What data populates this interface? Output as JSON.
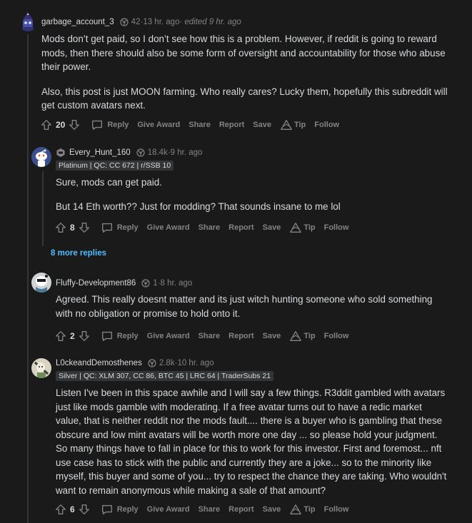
{
  "comments": [
    {
      "username": "garbage_account_3",
      "karma": "42",
      "time": "13 hr. ago",
      "edited": "edited 9 hr. ago",
      "paragraphs": [
        "Mods don’t get paid, so I don’t see how this is a problem. However, if reddit is going to reward mods, then there should also be some form of oversight and accountability for those who abuse their power.",
        "Also, this post is just MOON farming. Who really cares? Lucky them, hopefully this subreddit will get custom avatars next."
      ],
      "score": "20"
    },
    {
      "username": "Every_Hunt_160",
      "karma": "18.4k",
      "time": "9 hr. ago",
      "flair": "Platinum | QC: CC 672 | r/SSB 10",
      "paragraphs": [
        "Sure, mods can get paid.",
        "But 14 Eth worth?? Just for modding? That sounds insane to me lol"
      ],
      "score": "8"
    },
    {
      "username": "Fluffy-Development86",
      "karma": "1",
      "time": "8 hr. ago",
      "paragraphs": [
        "Agreed. This really doesnt matter and its just witch hunting someone who sold something with no obligation or promise to hold onto it."
      ],
      "score": "2"
    },
    {
      "username": "L0ckeandDemosthenes",
      "karma": "2.8k",
      "time": "10 hr. ago",
      "flair": "Silver | QC: XLM 307, CC 86, BTC 45 | LRC 64 | TraderSubs 21",
      "paragraphs": [
        "Listen I've been in this space awhile and I will say a few things. R3ddit gambled with avatars just like mods gamble with moderating. If a free avatar turns out to have a redic market value, that is neither reddit nor the mods fault.... there is a buyer who is gambling that these obscure and low mint avatars will be worth more one day ... so please hold your judgment. So many things have to fall in place for this to work for this investor. First and foremost... nft use case has to stick with the public and currently they are a joke... so to the minority like myself, this buyer and some of you... try to respect the chance they are taking. Who wouldn't want to remain anonymous while making a sale of that amount?"
      ],
      "score": "6"
    }
  ],
  "actions": {
    "reply": "Reply",
    "give_award": "Give Award",
    "share": "Share",
    "report": "Report",
    "save": "Save",
    "tip": "Tip",
    "follow": "Follow"
  },
  "more_replies": "8 more replies",
  "colors": {
    "background": "#1a1a1b",
    "text": "#d7dadc",
    "muted": "#818384",
    "link": "#4fbcff",
    "flair_bg": "#343536"
  }
}
